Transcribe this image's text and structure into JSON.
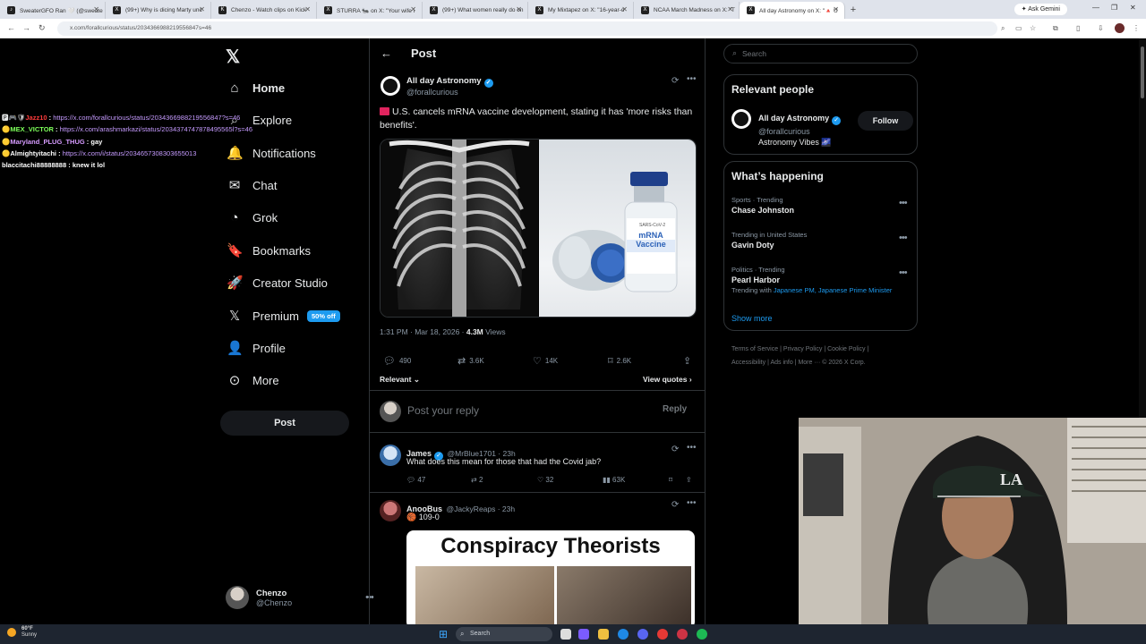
{
  "browser": {
    "tabs": [
      {
        "label": "SweaterGFO Ran 🤍 (@sweate",
        "fav": "♪"
      },
      {
        "label": "(99+) Why is dicing Marty unc",
        "fav": "X"
      },
      {
        "label": "Chenzo - Watch clips on Kick",
        "fav": "K"
      },
      {
        "label": "STURRA 🐜 on X: \"Your wife i",
        "fav": "X"
      },
      {
        "label": "(99+) What women really do on",
        "fav": "X"
      },
      {
        "label": "My Mixtapez on X: \"16-year-o",
        "fav": "X"
      },
      {
        "label": "NCAA March Madness on X: \"T",
        "fav": "X"
      },
      {
        "label": "All day Astronomy on X: \"🔺 U",
        "fav": "X"
      }
    ],
    "new_tab": "+",
    "ask_gemini": "Ask Gemini",
    "url": "x.com/forallcurious/status/2034366988219556847s=46"
  },
  "chat": [
    {
      "user": "Jazz10",
      "text": "https://x.com/forallcurious/status/2034366988219556847?s=46",
      "ucls": "u1",
      "tcls": "lnk",
      "badges": "🅿🎮🛡"
    },
    {
      "user": "MEX_VICTOR",
      "text": "https://x.com/arashmarkazi/status/2034374747878495565l?s=46",
      "ucls": "u2",
      "tcls": "lnk",
      "badges": "🟡"
    },
    {
      "user": "Maryland_PLUG_THUG",
      "text": "gay",
      "ucls": "u3",
      "tcls": "txt",
      "badges": "🟡"
    },
    {
      "user": "Almightyitachi",
      "text": "https://x.com/i/status/2034657308303655013",
      "ucls": "u4",
      "tcls": "lnk",
      "badges": "🟡"
    },
    {
      "user": "blaccitachi88888888",
      "text": "knew it lol",
      "ucls": "u4",
      "tcls": "txt",
      "badges": ""
    }
  ],
  "nav": {
    "items": [
      {
        "label": "Home",
        "icon": "⌂"
      },
      {
        "label": "Explore",
        "icon": "⌕"
      },
      {
        "label": "Notifications",
        "icon": "🔔"
      },
      {
        "label": "Chat",
        "icon": "✉"
      },
      {
        "label": "Grok",
        "icon": "◔"
      },
      {
        "label": "Bookmarks",
        "icon": "🔖"
      },
      {
        "label": "Creator Studio",
        "icon": "🚀"
      },
      {
        "label": "Premium",
        "icon": "𝕏"
      },
      {
        "label": "Profile",
        "icon": "👤"
      },
      {
        "label": "More",
        "icon": "⊙"
      }
    ],
    "premium_badge": "50% off",
    "post_button": "Post",
    "account": {
      "name": "Chenzo",
      "handle": "@Chenzo"
    }
  },
  "post": {
    "header_title": "Post",
    "author": {
      "name": "All day Astronomy",
      "handle": "@forallcurious"
    },
    "text": "U.S. cancels mRNA vaccine development, stating it has 'more risks than benefits'.",
    "vial_label_top": "SARS-CoV-2",
    "vial_label": "mRNA Vaccine",
    "time": "1:31 PM · Mar 18, 2026 · ",
    "views": "4.3M",
    "views_label": " Views",
    "stats": {
      "replies": "490",
      "reposts": "3.6K",
      "likes": "14K",
      "bookmarks": "2.6K"
    },
    "sort_label": "Relevant",
    "view_quotes": "View quotes",
    "reply_placeholder": "Post your reply",
    "reply_button": "Reply"
  },
  "replies": [
    {
      "name": "James",
      "meta": "@MrBlue1701 · 23h",
      "text": "What does this mean for those that had the Covid jab?",
      "stats": {
        "replies": "47",
        "reposts": "2",
        "likes": "32",
        "views": "63K"
      }
    },
    {
      "name": "AnooBus",
      "meta": "@JackyReaps · 23h",
      "text": "🏀 109-0",
      "meme_title": "Conspiracy Theorists"
    }
  ],
  "right": {
    "search_placeholder": "Search",
    "relevant_title": "Relevant people",
    "person": {
      "name": "All day Astronomy",
      "handle": "@forallcurious",
      "bio": "Astronomy Vibes 🌌",
      "follow": "Follow"
    },
    "happening_title": "What’s happening",
    "trends": [
      {
        "meta": "Sports · Trending",
        "name": "Chase Johnston",
        "with_label": "",
        "with_links": ""
      },
      {
        "meta": "Trending in United States",
        "name": "Gavin Doty",
        "with_label": "",
        "with_links": ""
      },
      {
        "meta": "Politics · Trending",
        "name": "Pearl Harbor",
        "with_label": "Trending with ",
        "with_links": "Japanese PM, Japanese Prime Minister"
      }
    ],
    "show_more": "Show more",
    "footer_line1": "Terms of Service  |  Privacy Policy  |  Cookie Policy  |",
    "footer_line2": "Accessibility  |  Ads info  |  More ···  © 2026 X Corp."
  },
  "taskbar": {
    "search": "Search",
    "weather_temp": "60°F",
    "weather_desc": "Sunny"
  },
  "colors": {
    "accent": "#1d9bf0",
    "background": "#000000",
    "border": "#2f3336",
    "muted": "#8b98a5"
  }
}
